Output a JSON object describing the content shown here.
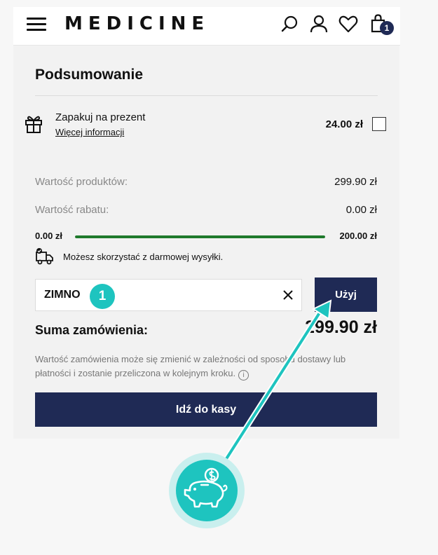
{
  "header": {
    "logo": "MEDICINE",
    "cart_count": "1"
  },
  "summary": {
    "title": "Podsumowanie",
    "gift": {
      "title": "Zapakuj na prezent",
      "link": "Więcej informacji",
      "price": "24.00 zł"
    },
    "products_label": "Wartość produktów:",
    "products_value": "299.90 zł",
    "discount_label": "Wartość rabatu:",
    "discount_value": "0.00 zł",
    "shipping_progress": {
      "min_label": "0.00 zł",
      "max_label": "200.00 zł",
      "fill_fraction": 1.0
    },
    "free_shipping_text": "Możesz skorzystać z darmowej wysyłki.",
    "coupon": {
      "value": "ZIMNO",
      "apply_label": "Użyj",
      "step_number": "1"
    },
    "total_label": "Suma zamówienia:",
    "total_value": "299.90 zł",
    "note": "Wartość zamówienia może się zmienić w zależności od sposobu dostawy lub płatności i zostanie przeliczona w kolejnym kroku.",
    "info_symbol": "i",
    "checkout_label": "Idź do kasy"
  },
  "colors": {
    "brand_navy": "#1f2a55",
    "progress_green": "#1f7a2c",
    "accent_teal": "#1ec4bf"
  }
}
